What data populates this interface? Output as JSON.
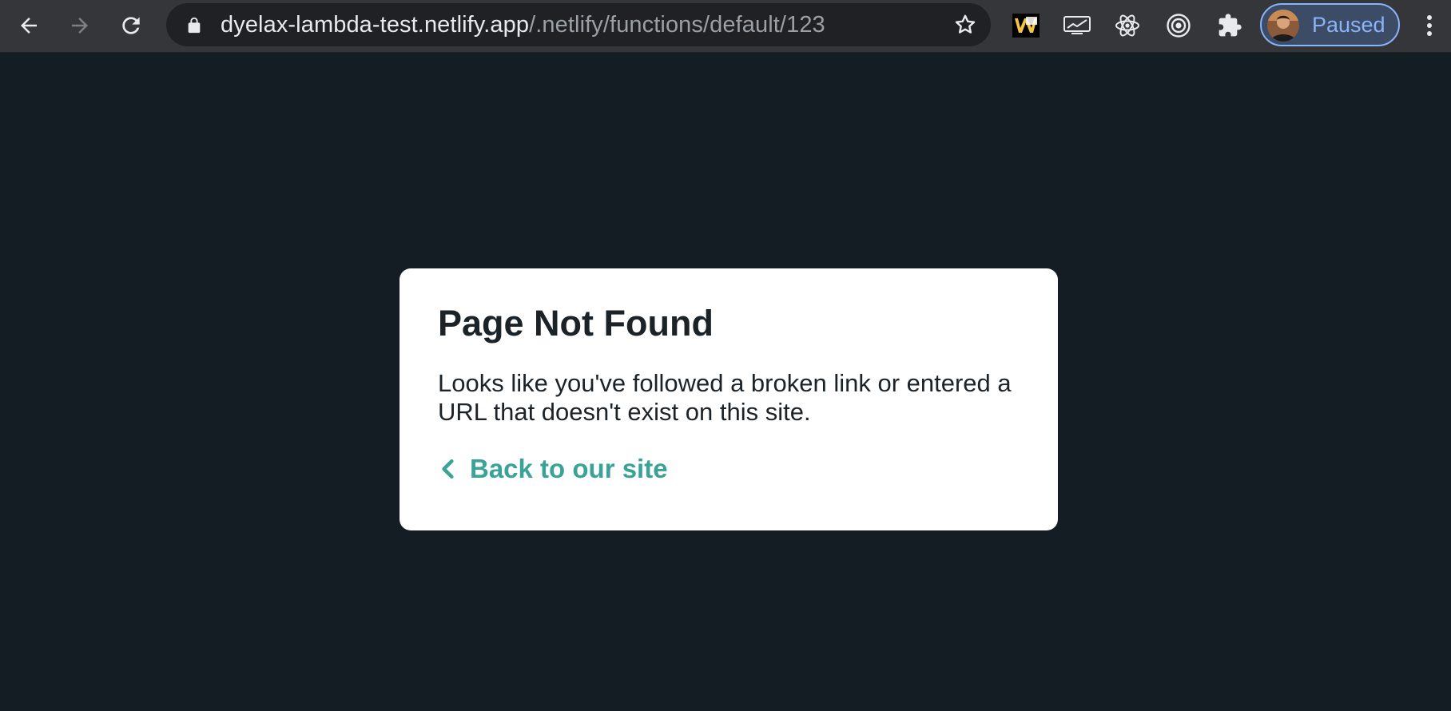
{
  "browser": {
    "url_host": "dyelax-lambda-test.netlify.app",
    "url_path": "/.netlify/functions/default/123",
    "profile_label": "Paused",
    "icons": {
      "back": "arrow-left-icon",
      "forward": "arrow-right-icon",
      "reload": "reload-icon",
      "lock": "lock-icon",
      "bookmark": "star-icon",
      "extensions": [
        "w-extension-icon",
        "screen-extension-icon",
        "react-devtools-icon",
        "target-extension-icon",
        "puzzle-icon"
      ],
      "menu": "kebab-menu-icon"
    }
  },
  "page": {
    "title": "Page Not Found",
    "message": "Looks like you've followed a broken link or entered a URL that doesn't exist on this site.",
    "back_link": "Back to our site"
  },
  "colors": {
    "page_background": "#141d23",
    "card_background": "#ffffff",
    "text": "#1b2329",
    "link": "#3aa397",
    "toolbar": "#35363a",
    "omnibox": "#202124",
    "profile_accent": "#8ab4f8"
  }
}
